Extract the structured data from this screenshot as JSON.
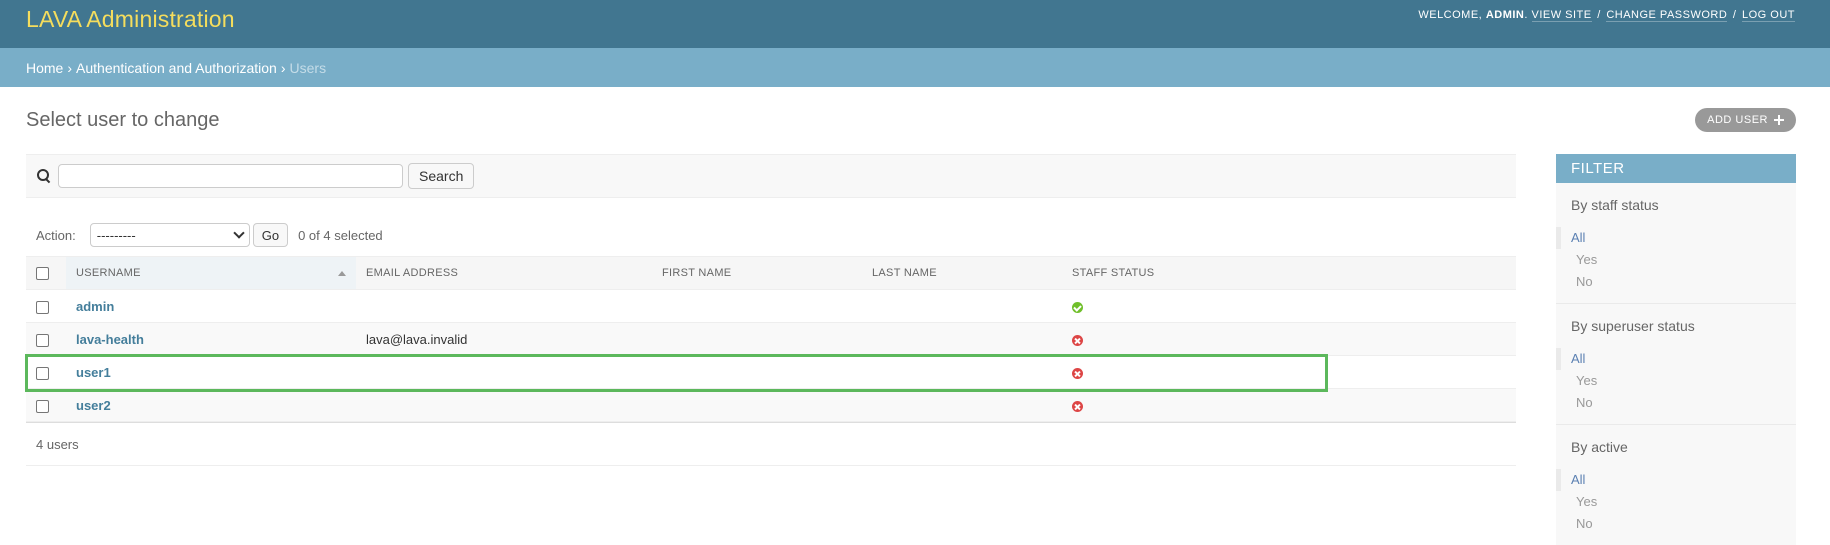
{
  "header": {
    "branding": "LAVA Administration",
    "welcome": "WELCOME,",
    "username": "ADMIN",
    "view_site": "VIEW SITE",
    "change_password": "CHANGE PASSWORD",
    "log_out": "LOG OUT"
  },
  "breadcrumbs": {
    "home": "Home",
    "auth": "Authentication and Authorization",
    "current": "Users"
  },
  "page": {
    "title": "Select user to change",
    "add_button": "ADD USER"
  },
  "search": {
    "value": "",
    "placeholder": "",
    "button": "Search"
  },
  "actions": {
    "label": "Action:",
    "selected_value": "---------",
    "go": "Go",
    "selected_count": "0 of 4 selected"
  },
  "table": {
    "headers": [
      "USERNAME",
      "EMAIL ADDRESS",
      "FIRST NAME",
      "LAST NAME",
      "STAFF STATUS"
    ],
    "rows": [
      {
        "username": "admin",
        "email": "",
        "first_name": "",
        "last_name": "",
        "staff": true
      },
      {
        "username": "lava-health",
        "email": "lava@lava.invalid",
        "first_name": "",
        "last_name": "",
        "staff": false
      },
      {
        "username": "user1",
        "email": "",
        "first_name": "",
        "last_name": "",
        "staff": false
      },
      {
        "username": "user2",
        "email": "",
        "first_name": "",
        "last_name": "",
        "staff": false
      }
    ]
  },
  "paginator": {
    "count": "4 users"
  },
  "filter": {
    "title": "FILTER",
    "groups": [
      {
        "title": "By staff status",
        "options": [
          "All",
          "Yes",
          "No"
        ]
      },
      {
        "title": "By superuser status",
        "options": [
          "All",
          "Yes",
          "No"
        ]
      },
      {
        "title": "By active",
        "options": [
          "All",
          "Yes",
          "No"
        ]
      }
    ]
  },
  "colors": {
    "header_bg": "#417690",
    "branding": "#f5dd5d",
    "breadcrumb_bg": "#79aec8",
    "link": "#447e9b",
    "highlight": "#5cb85c",
    "status_yes": "#70bf2b",
    "status_no": "#dd4646"
  }
}
